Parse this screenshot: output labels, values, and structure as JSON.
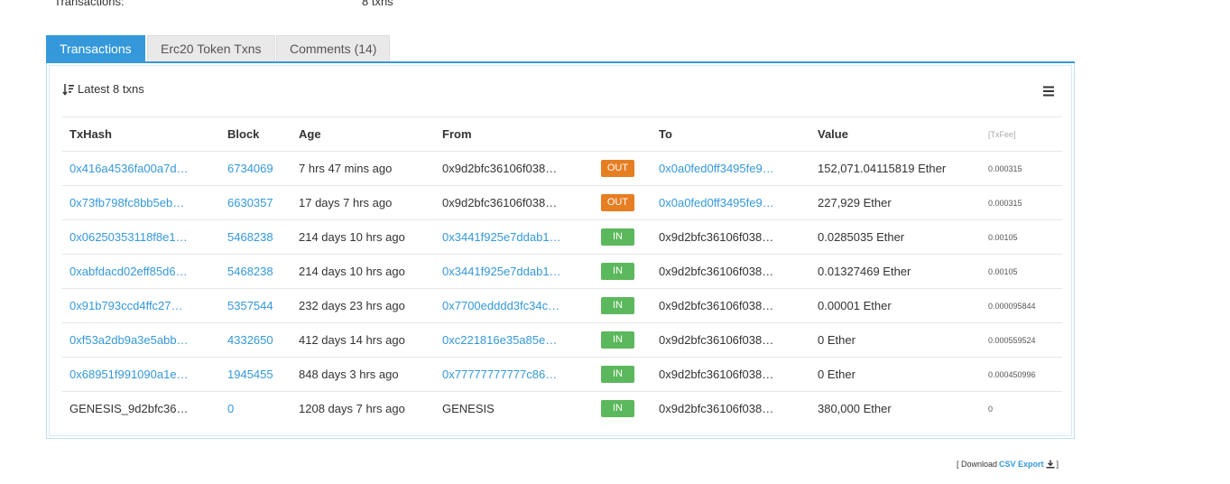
{
  "summary_row": {
    "label": "Transactions:",
    "value": "8 txns"
  },
  "tabs": [
    {
      "label": "Transactions",
      "active": true
    },
    {
      "label": "Erc20 Token Txns",
      "active": false
    },
    {
      "label": "Comments (14)",
      "active": false
    }
  ],
  "panel": {
    "summary_text": "Latest 8 txns",
    "columns": {
      "txhash": "TxHash",
      "block": "Block",
      "age": "Age",
      "from": "From",
      "to": "To",
      "value": "Value",
      "txfee": "[TxFee]"
    },
    "rows": [
      {
        "txhash": "0x416a4536fa00a7d…",
        "block": "6734069",
        "age": "7 hrs 47 mins ago",
        "from": "0x9d2bfc36106f038…",
        "direction": "OUT",
        "to": "0x0a0fed0ff3495fe9…",
        "value": "152,071.04115819 Ether",
        "fee": "0.000315"
      },
      {
        "txhash": "0x73fb798fc8bb5eb…",
        "block": "6630357",
        "age": "17 days 7 hrs ago",
        "from": "0x9d2bfc36106f038…",
        "direction": "OUT",
        "to": "0x0a0fed0ff3495fe9…",
        "value": "227,929 Ether",
        "fee": "0.000315"
      },
      {
        "txhash": "0x06250353118f8e1…",
        "block": "5468238",
        "age": "214 days 10 hrs ago",
        "from": "0x3441f925e7ddab1…",
        "direction": "IN",
        "to": "0x9d2bfc36106f038…",
        "value": "0.0285035 Ether",
        "fee": "0.00105"
      },
      {
        "txhash": "0xabfdacd02eff85d6…",
        "block": "5468238",
        "age": "214 days 10 hrs ago",
        "from": "0x3441f925e7ddab1…",
        "direction": "IN",
        "to": "0x9d2bfc36106f038…",
        "value": "0.01327469 Ether",
        "fee": "0.00105"
      },
      {
        "txhash": "0x91b793ccd4ffc27…",
        "block": "5357544",
        "age": "232 days 23 hrs ago",
        "from": "0x7700edddd3fc34c…",
        "direction": "IN",
        "to": "0x9d2bfc36106f038…",
        "value": "0.00001 Ether",
        "fee": "0.000095844"
      },
      {
        "txhash": "0xf53a2db9a3e5abb…",
        "block": "4332650",
        "age": "412 days 14 hrs ago",
        "from": "0xc221816e35a85e…",
        "direction": "IN",
        "to": "0x9d2bfc36106f038…",
        "value": "0 Ether",
        "fee": "0.000559524"
      },
      {
        "txhash": "0x68951f991090a1e…",
        "block": "1945455",
        "age": "848 days 3 hrs ago",
        "from": "0x77777777777c86…",
        "direction": "IN",
        "to": "0x9d2bfc36106f038…",
        "value": "0 Ether",
        "fee": "0.000450996"
      },
      {
        "txhash": "GENESIS_9d2bfc36…",
        "block": "0",
        "age": "1208 days 7 hrs ago",
        "from": "GENESIS",
        "direction": "IN",
        "to": "0x9d2bfc36106f038…",
        "value": "380,000 Ether",
        "fee": "0"
      }
    ]
  },
  "csv": {
    "prefix": "[ Download",
    "link": "CSV Export",
    "suffix": "]"
  },
  "colors": {
    "accent": "#3498db",
    "out_badge": "#e67e22",
    "in_badge": "#5cb85c"
  },
  "icons": {
    "sort": "sort-icon",
    "menu": "hamburger-menu-icon",
    "download": "download-icon"
  }
}
